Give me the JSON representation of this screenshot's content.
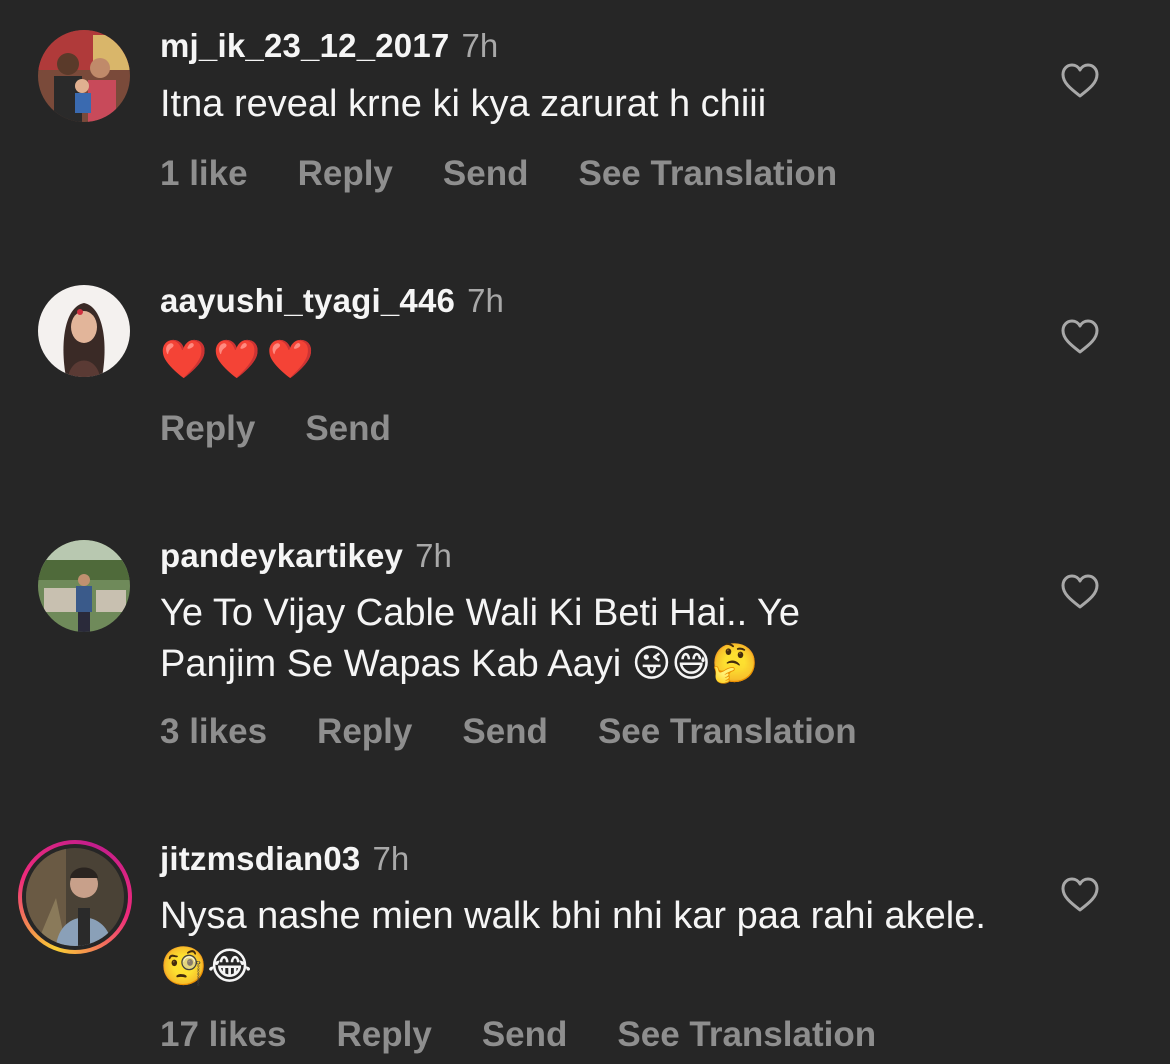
{
  "comments": [
    {
      "username": "mj_ik_23_12_2017",
      "time": "7h",
      "text": "Itna reveal krne ki kya zarurat h chiii",
      "likes": "1 like",
      "reply": "Reply",
      "send": "Send",
      "translate": "See Translation"
    },
    {
      "username": "aayushi_tyagi_446",
      "time": "7h",
      "text": "❤️❤️❤️",
      "reply": "Reply",
      "send": "Send"
    },
    {
      "username": "pandeykartikey",
      "time": "7h",
      "text": "Ye To Vijay Cable Wali Ki Beti Hai.. Ye Panjim Se Wapas Kab Aayi 😜😅🤔",
      "likes": "3 likes",
      "reply": "Reply",
      "send": "Send",
      "translate": "See Translation"
    },
    {
      "username": "jitzmsdian03",
      "time": "7h",
      "text": "Nysa nashe mien walk bhi nhi kar paa rahi akele.🧐😂",
      "likes": "17 likes",
      "reply": "Reply",
      "send": "Send",
      "translate": "See Translation"
    }
  ],
  "icons": {
    "like": "heart-outline-icon"
  },
  "colors": {
    "background": "#262626",
    "primary_text": "#f5f5f5",
    "secondary_text": "#a8a8a8",
    "action_text": "#8e8e8e",
    "story_ring": "#ee2a7b"
  }
}
